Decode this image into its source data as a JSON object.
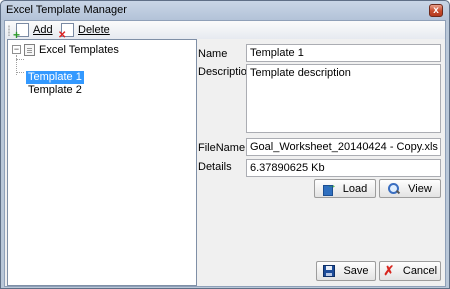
{
  "window": {
    "title": "Excel Template Manager",
    "close_glyph": "x"
  },
  "toolbar": {
    "add_label": "Add",
    "delete_label": "Delete"
  },
  "tree": {
    "root_label": "Excel Templates",
    "expander_glyph": "−",
    "items": [
      {
        "label": "Template 1",
        "selected": true
      },
      {
        "label": "Template 2",
        "selected": false
      }
    ]
  },
  "form": {
    "name_label": "Name",
    "name_value": "Template 1",
    "description_label": "Description",
    "description_value": "Template description",
    "filename_label": "FileName",
    "filename_value": "Goal_Worksheet_20140424 - Copy.xls",
    "details_label": "Details",
    "details_value": "6.37890625 Kb"
  },
  "buttons": {
    "load_label": "Load",
    "view_label": "View",
    "save_label": "Save",
    "cancel_label": "Cancel"
  },
  "colors": {
    "selection": "#3399ff",
    "window_frame": "#b9c7d8",
    "client_bg": "#f0f0f0"
  }
}
